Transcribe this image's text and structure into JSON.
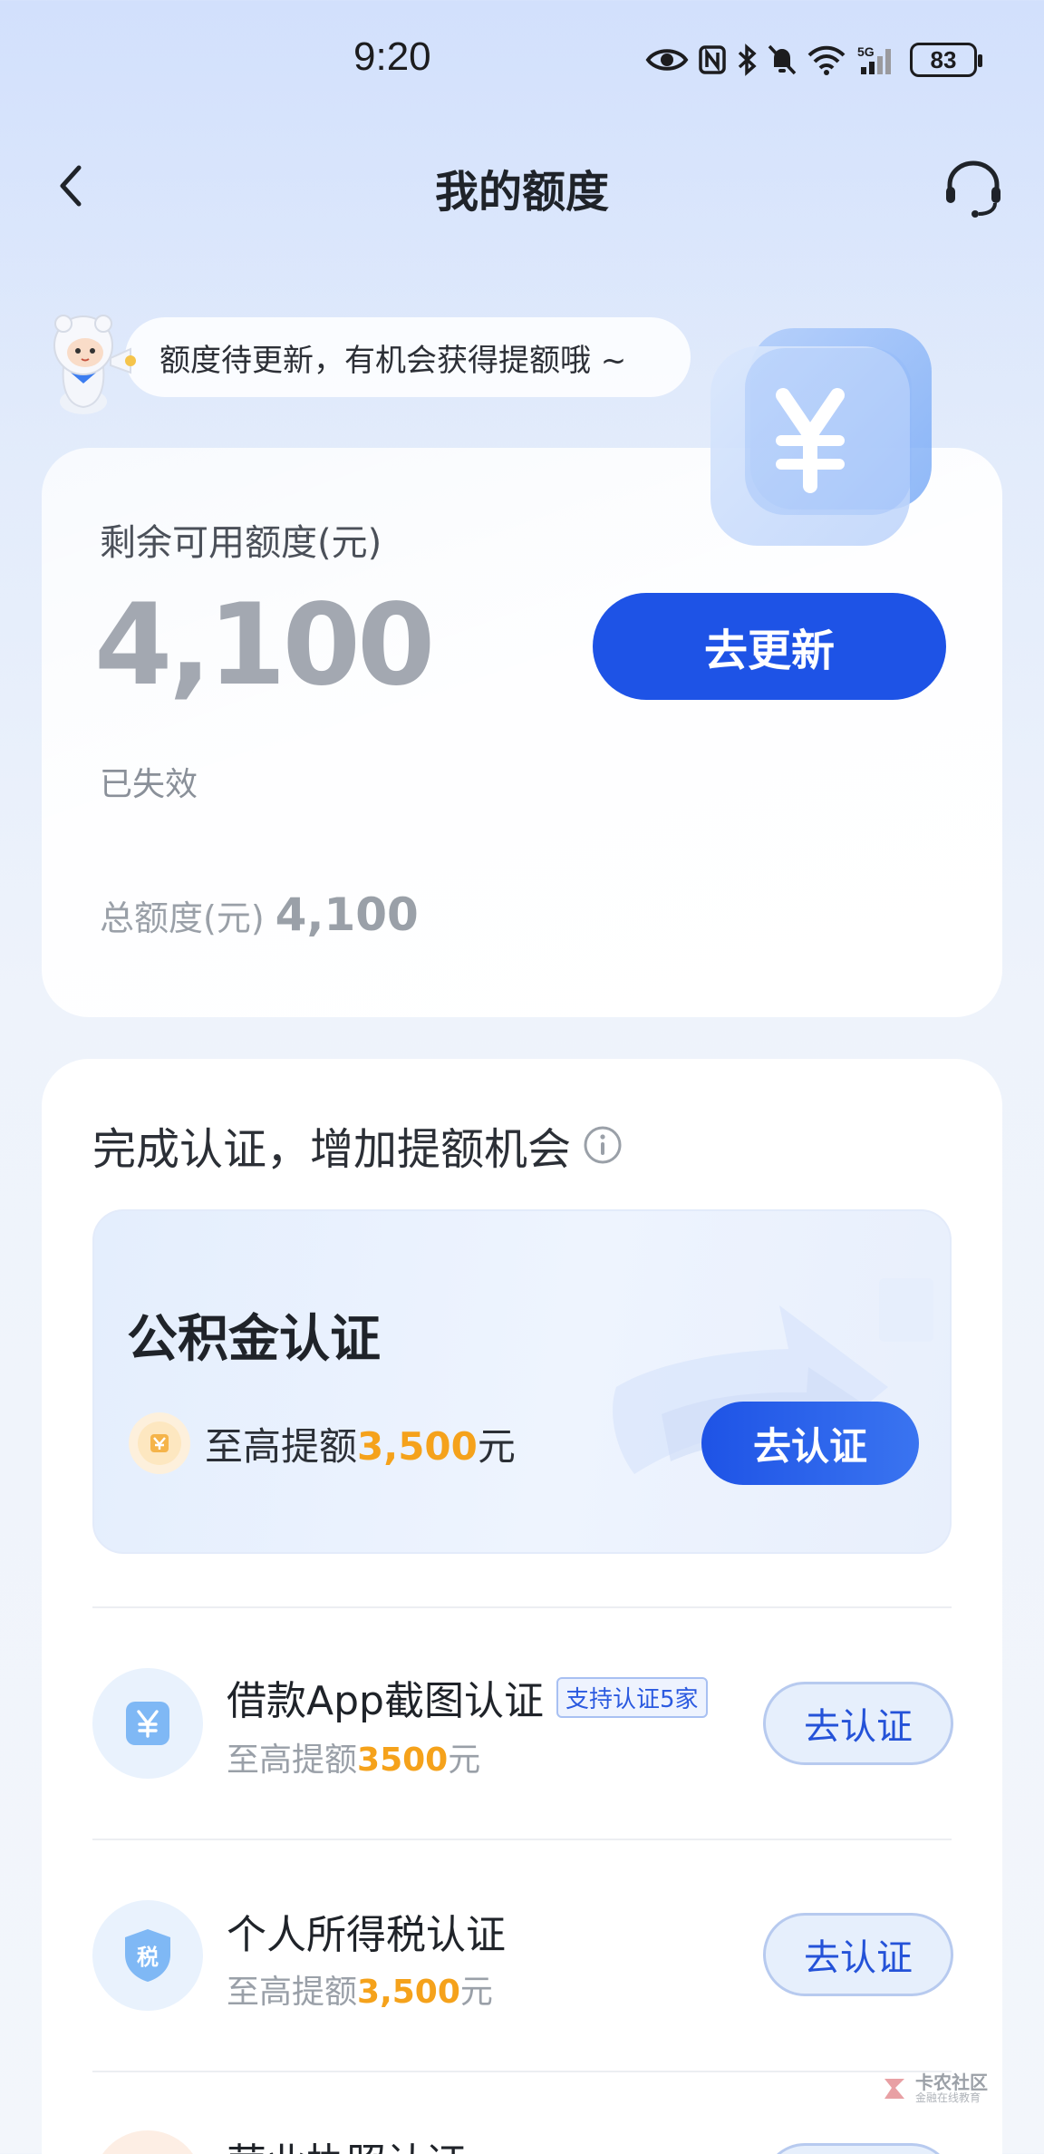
{
  "status_bar": {
    "time": "9:20",
    "network": "5G",
    "battery": "83"
  },
  "header": {
    "title": "我的额度"
  },
  "tip": {
    "text": "额度待更新，有机会获得提额哦 ~"
  },
  "credit": {
    "label": "剩余可用额度(元)",
    "amount": "4,100",
    "update_button": "去更新",
    "status": "已失效",
    "total_label": "总额度(元)",
    "total_amount": "4,100"
  },
  "auth": {
    "title": "完成认证，增加提额机会",
    "featured": {
      "title": "公积金认证",
      "sub_prefix": "至高提额",
      "sub_amount": "3,500",
      "sub_suffix": "元",
      "button": "去认证"
    },
    "items": [
      {
        "title": "借款App截图认证",
        "badge": "支持认证5家",
        "sub_prefix": "至高提额",
        "sub_amount": "3500",
        "sub_suffix": "元",
        "button": "去认证",
        "icon": "yen-icon"
      },
      {
        "title": "个人所得税认证",
        "sub_prefix": "至高提额",
        "sub_amount": "3,500",
        "sub_suffix": "元",
        "button": "去认证",
        "icon": "tax-icon",
        "icon_text": "税"
      },
      {
        "title": "营业执照认证",
        "icon": "license-icon"
      }
    ]
  },
  "watermark": {
    "line1": "卡农社区",
    "line2": "金融在线教育"
  },
  "colors": {
    "primary": "#1e53e6",
    "highlight": "#f5a21b",
    "muted": "#a3a8b1"
  }
}
